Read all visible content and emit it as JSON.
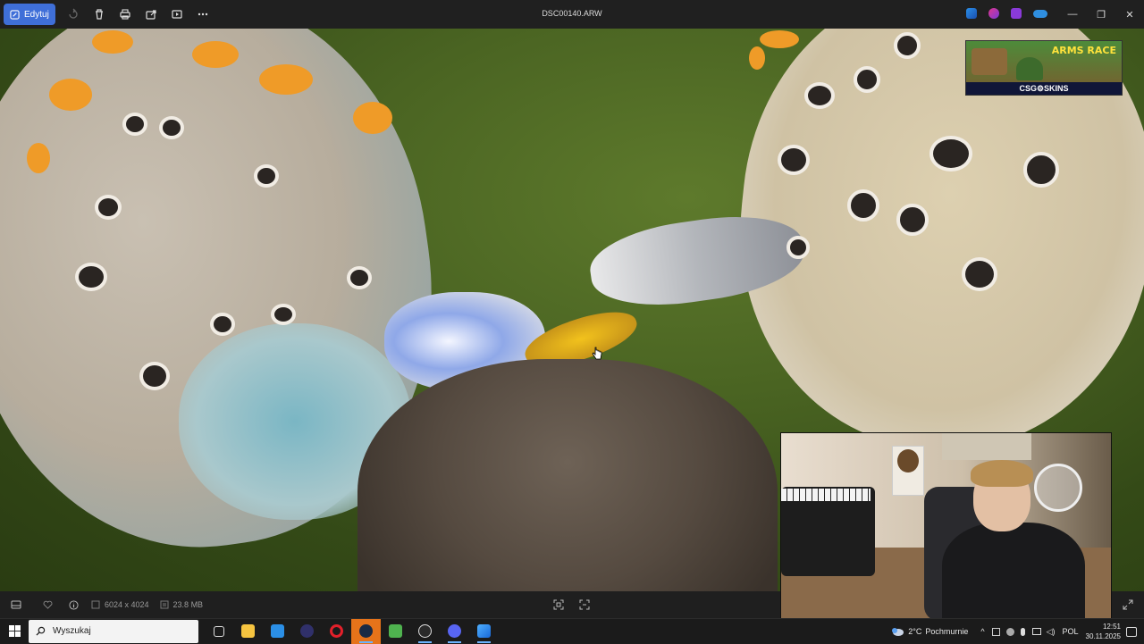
{
  "toolbar": {
    "edit_label": "Edytuj",
    "file_title": "DSC00140.ARW",
    "icons": [
      "edit-icon",
      "rotate-icon",
      "delete-icon",
      "print-icon",
      "share-icon",
      "slideshow-icon",
      "more-icon"
    ],
    "right_icons": [
      "sharex-icon",
      "app2-icon",
      "app3-icon",
      "onedrive-icon"
    ],
    "minimize": "—",
    "maximize": "❐",
    "close": "✕"
  },
  "status_bar": {
    "dimensions": "6024 x 4024",
    "file_size": "23.8 MB"
  },
  "overlay_ad": {
    "title": "ARMS RACE",
    "brand": "CSG⚙SKINS"
  },
  "taskbar": {
    "search_placeholder": "Wyszukaj",
    "weather_temp": "2°C",
    "weather_text": "Pochmurnie",
    "language": "POL",
    "time": "12:51",
    "date": "30.11.2025",
    "apps": [
      "task-view-icon",
      "file-explorer-icon",
      "vscode-icon",
      "app-icon",
      "opera-icon",
      "steam-icon",
      "notepad-icon",
      "obs-icon",
      "discord-icon",
      "photos-icon"
    ]
  },
  "colors": {
    "accent": "#3f6fd8",
    "background": "#202020",
    "taskbar": "#1b1b1b"
  }
}
